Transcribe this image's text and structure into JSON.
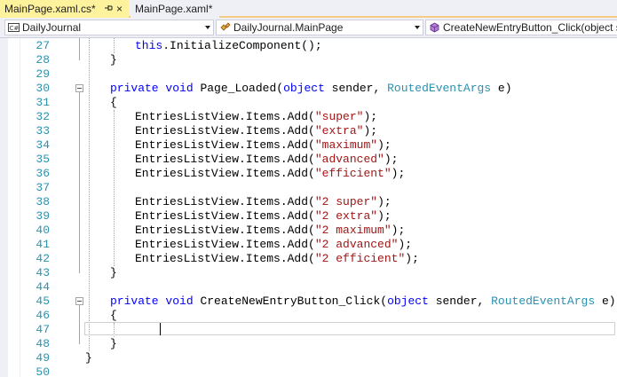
{
  "tabs": [
    {
      "label": "MainPage.xaml.cs*",
      "active": true,
      "pinned": false
    },
    {
      "label": "MainPage.xaml*",
      "active": false
    }
  ],
  "nav": {
    "project": {
      "label": "DailyJournal",
      "icon": "csharp-project-icon"
    },
    "class": {
      "label": "DailyJournal.MainPage",
      "icon": "class-icon"
    },
    "member": {
      "label": "CreateNewEntryButton_Click(object s",
      "icon": "method-icon"
    }
  },
  "editor": {
    "lines": [
      {
        "n": "27",
        "tokens": [
          [
            "this",
            "kw"
          ],
          [
            ".InitializeComponent();",
            ""
          ]
        ],
        "indent": 2
      },
      {
        "n": "28",
        "tokens": [
          [
            "}",
            ""
          ]
        ],
        "indent": 1
      },
      {
        "n": "29",
        "tokens": [],
        "indent": 0
      },
      {
        "n": "30",
        "tokens": [
          [
            "private",
            "kw"
          ],
          [
            " ",
            ""
          ],
          [
            "void",
            "kw"
          ],
          [
            " Page_Loaded(",
            ""
          ],
          [
            "object",
            "kw"
          ],
          [
            " sender, ",
            ""
          ],
          [
            "RoutedEventArgs",
            "ty"
          ],
          [
            " e)",
            ""
          ]
        ],
        "indent": 1
      },
      {
        "n": "31",
        "tokens": [
          [
            "{",
            ""
          ]
        ],
        "indent": 1
      },
      {
        "n": "32",
        "tokens": [
          [
            "EntriesListView.Items.Add(",
            ""
          ],
          [
            "\"super\"",
            "st"
          ],
          [
            ");",
            ""
          ]
        ],
        "indent": 2
      },
      {
        "n": "33",
        "tokens": [
          [
            "EntriesListView.Items.Add(",
            ""
          ],
          [
            "\"extra\"",
            "st"
          ],
          [
            ");",
            ""
          ]
        ],
        "indent": 2
      },
      {
        "n": "34",
        "tokens": [
          [
            "EntriesListView.Items.Add(",
            ""
          ],
          [
            "\"maximum\"",
            "st"
          ],
          [
            ");",
            ""
          ]
        ],
        "indent": 2
      },
      {
        "n": "35",
        "tokens": [
          [
            "EntriesListView.Items.Add(",
            ""
          ],
          [
            "\"advanced\"",
            "st"
          ],
          [
            ");",
            ""
          ]
        ],
        "indent": 2
      },
      {
        "n": "36",
        "tokens": [
          [
            "EntriesListView.Items.Add(",
            ""
          ],
          [
            "\"efficient\"",
            "st"
          ],
          [
            ");",
            ""
          ]
        ],
        "indent": 2
      },
      {
        "n": "37",
        "tokens": [],
        "indent": 0
      },
      {
        "n": "38",
        "tokens": [
          [
            "EntriesListView.Items.Add(",
            ""
          ],
          [
            "\"2 super\"",
            "st"
          ],
          [
            ");",
            ""
          ]
        ],
        "indent": 2
      },
      {
        "n": "39",
        "tokens": [
          [
            "EntriesListView.Items.Add(",
            ""
          ],
          [
            "\"2 extra\"",
            "st"
          ],
          [
            ");",
            ""
          ]
        ],
        "indent": 2
      },
      {
        "n": "40",
        "tokens": [
          [
            "EntriesListView.Items.Add(",
            ""
          ],
          [
            "\"2 maximum\"",
            "st"
          ],
          [
            ");",
            ""
          ]
        ],
        "indent": 2
      },
      {
        "n": "41",
        "tokens": [
          [
            "EntriesListView.Items.Add(",
            ""
          ],
          [
            "\"2 advanced\"",
            "st"
          ],
          [
            ");",
            ""
          ]
        ],
        "indent": 2
      },
      {
        "n": "42",
        "tokens": [
          [
            "EntriesListView.Items.Add(",
            ""
          ],
          [
            "\"2 efficient\"",
            "st"
          ],
          [
            ");",
            ""
          ]
        ],
        "indent": 2
      },
      {
        "n": "43",
        "tokens": [
          [
            "}",
            ""
          ]
        ],
        "indent": 1
      },
      {
        "n": "44",
        "tokens": [],
        "indent": 0
      },
      {
        "n": "45",
        "tokens": [
          [
            "private",
            "kw"
          ],
          [
            " ",
            ""
          ],
          [
            "void",
            "kw"
          ],
          [
            " CreateNewEntryButton_Click(",
            ""
          ],
          [
            "object",
            "kw"
          ],
          [
            " sender, ",
            ""
          ],
          [
            "RoutedEventArgs",
            "ty"
          ],
          [
            " e)",
            ""
          ]
        ],
        "indent": 1
      },
      {
        "n": "46",
        "tokens": [
          [
            "{",
            ""
          ]
        ],
        "indent": 1
      },
      {
        "n": "47",
        "tokens": [],
        "indent": 0
      },
      {
        "n": "48",
        "tokens": [
          [
            "}",
            ""
          ]
        ],
        "indent": 1
      },
      {
        "n": "49",
        "tokens": [
          [
            "}",
            ""
          ]
        ],
        "indent": 0
      },
      {
        "n": "50",
        "tokens": [],
        "indent": 0
      }
    ],
    "current_line": "47"
  },
  "colors": {
    "tab_active_bg": "#fff29d",
    "keyword": "#0000ff",
    "type": "#2b91af",
    "string": "#a31515",
    "line_number": "#2b91af"
  }
}
